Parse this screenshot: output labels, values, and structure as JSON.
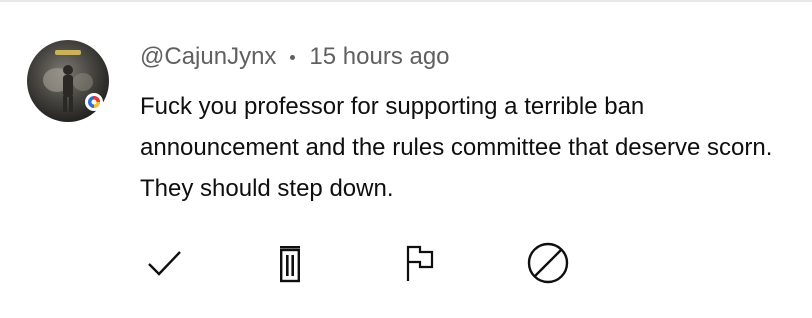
{
  "comment": {
    "author": "@CajunJynx",
    "time": "15 hours ago",
    "text": "Fuck you professor for supporting a terrible ban announcement and the rules committee that deserve scorn. They should step down."
  },
  "actions": [
    {
      "icon": "check-icon",
      "label": "approve"
    },
    {
      "icon": "trash-icon",
      "label": "remove"
    },
    {
      "icon": "flag-icon",
      "label": "report"
    },
    {
      "icon": "ban-icon",
      "label": "hide user"
    }
  ],
  "colors": {
    "text": "#0f0f0f",
    "meta": "#606060",
    "divider": "#e8e8e8"
  }
}
